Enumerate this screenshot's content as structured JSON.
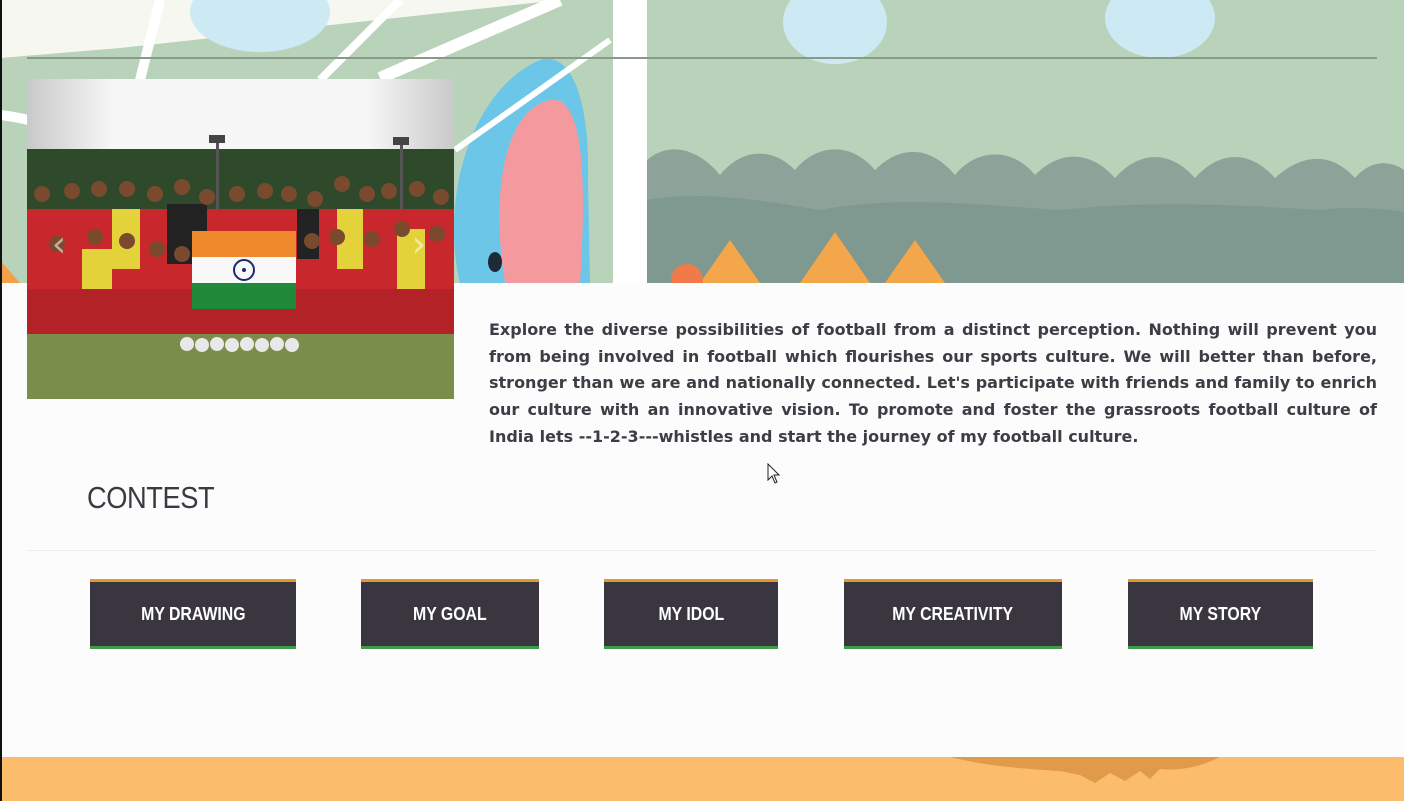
{
  "hero": {
    "banner_alt": "football field illustration banner",
    "photo_alt": "India football team holding national flag"
  },
  "carousel": {
    "prev_icon": "chevron-left-icon",
    "next_icon": "chevron-right-icon",
    "prev_glyph": "‹",
    "next_glyph": "›"
  },
  "intro": {
    "text": "Explore the diverse possibilities of football from a distinct perception. Nothing will prevent you from being involved in football which flourishes our sports culture. We will better than before, stronger than we are and nationally connected. Let's participate with friends and family to enrich our culture with an innovative vision. To promote and foster the grassroots football culture of India lets --1-2-3---whistles and start the journey of my football culture."
  },
  "contest": {
    "title": "CONTEST",
    "buttons": [
      {
        "label": "MY DRAWING"
      },
      {
        "label": "MY GOAL"
      },
      {
        "label": "MY IDOL"
      },
      {
        "label": "MY CREATIVITY"
      },
      {
        "label": "MY STORY"
      }
    ]
  },
  "colors": {
    "button_bg": "#3a3640",
    "button_top_accent": "#e09a2e",
    "button_bottom_accent": "#3f9a49",
    "hero_green": "#b9d3bb",
    "footer_orange": "#fbbd6b",
    "text": "#3d3d45"
  }
}
